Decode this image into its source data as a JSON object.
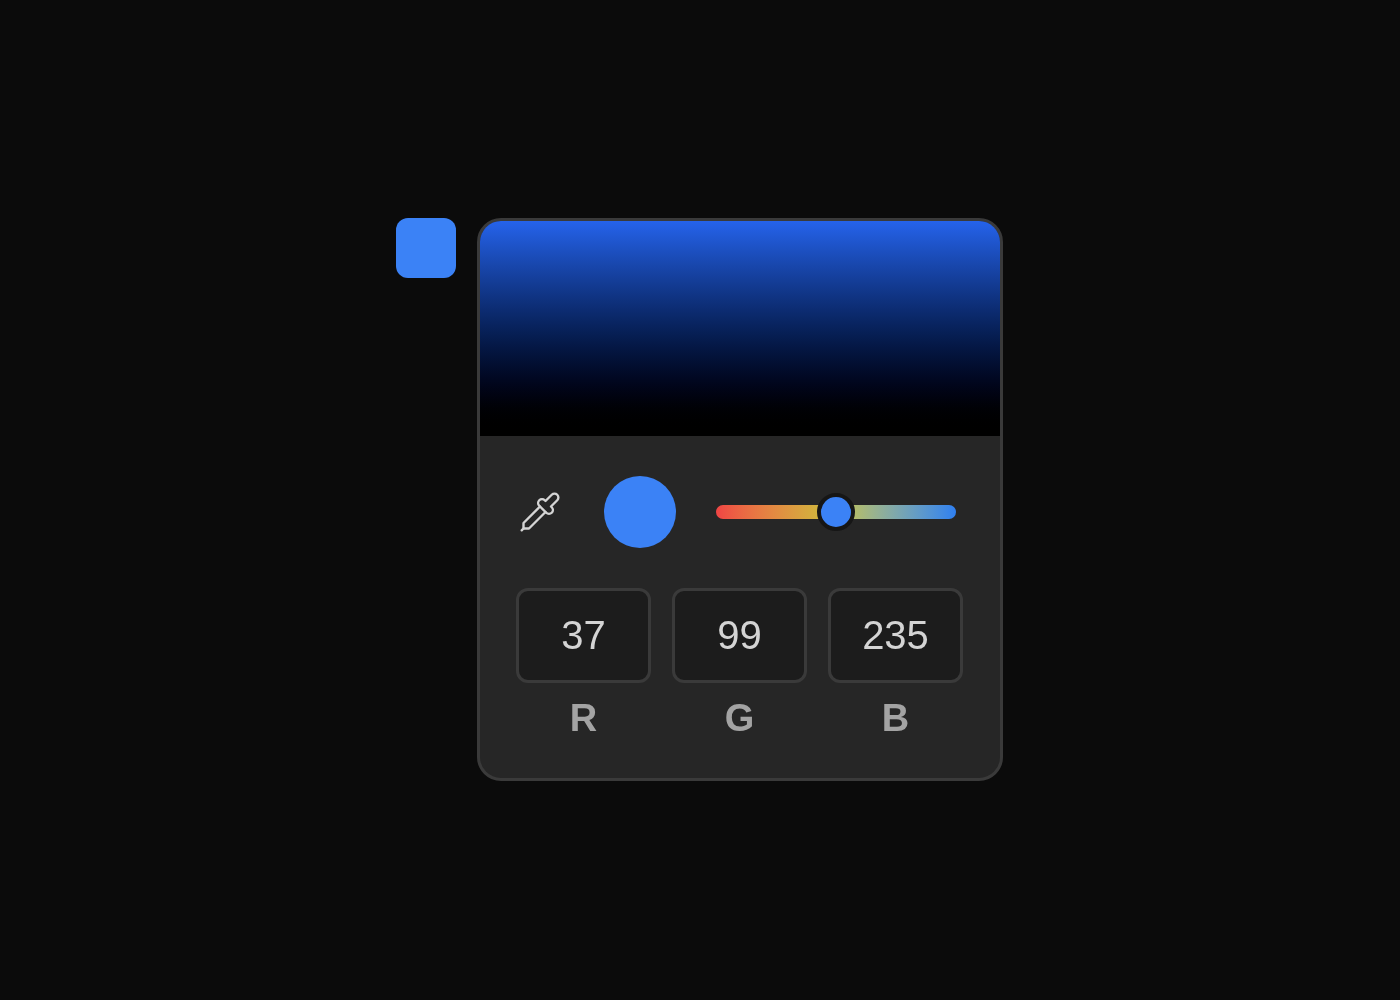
{
  "picker": {
    "color": "#3b82f6",
    "hue": {
      "level": 0.5
    },
    "channels": [
      {
        "label": "R",
        "value": "37"
      },
      {
        "label": "G",
        "value": "99"
      },
      {
        "label": "B",
        "value": "235"
      }
    ]
  }
}
